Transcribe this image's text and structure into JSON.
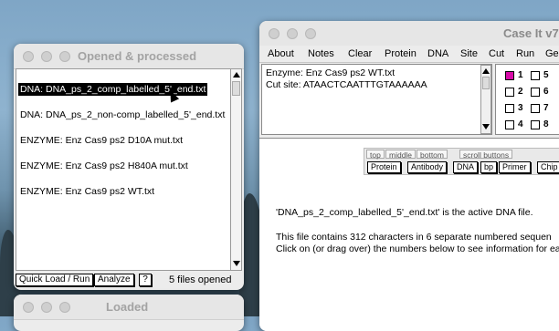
{
  "opened_window": {
    "title": "Opened & processed",
    "items": [
      {
        "label": "DNA: DNA_ps_2_comp_labelled_5'_end.txt",
        "selected": true
      },
      {
        "label": "DNA: DNA_ps_2_non-comp_labelled_5'_end.txt",
        "selected": false
      },
      {
        "label": "ENZYME: Enz Cas9 ps2 D10A mut.txt",
        "selected": false
      },
      {
        "label": "ENZYME: Enz Cas9 ps2 H840A mut.txt",
        "selected": false
      },
      {
        "label": "ENZYME: Enz Cas9 ps2 WT.txt",
        "selected": false
      }
    ],
    "quick_load_label": "Quick Load / Run",
    "analyze_label": "Analyze",
    "help_label": "?",
    "status": "5   files opened"
  },
  "loaded_window": {
    "title": "Loaded"
  },
  "caseit_window": {
    "title": "Case It v7",
    "menu": [
      "About",
      "Notes",
      "Clear",
      "Protein",
      "DNA",
      "Site",
      "Cut",
      "Run",
      "Ge"
    ],
    "info": {
      "enzyme_line": "Enzyme: Enz Cas9 ps2 WT.txt",
      "cut_line": "Cut site: ATAACTCAATTTGTAAAAAA"
    },
    "grid_numbers": [
      "1",
      "2",
      "3",
      "4",
      "5",
      "6",
      "7",
      "8"
    ],
    "panel_tabs": [
      "top",
      "middle",
      "bottom",
      "scroll buttons"
    ],
    "panel_buttons": [
      "Protein",
      "Antibody",
      "DNA",
      "bp",
      "Primer",
      "Chip"
    ],
    "messages": {
      "active": "'DNA_ps_2_comp_labelled_5'_end.txt' is the active DNA file.",
      "contains": "This file contains 312 characters in 6 separate numbered sequen",
      "click": "Click on (or drag over) the numbers below to see information for ea"
    }
  },
  "colors": {
    "selected_checkbox": "#d80aa8",
    "selection_bg": "#000000"
  }
}
